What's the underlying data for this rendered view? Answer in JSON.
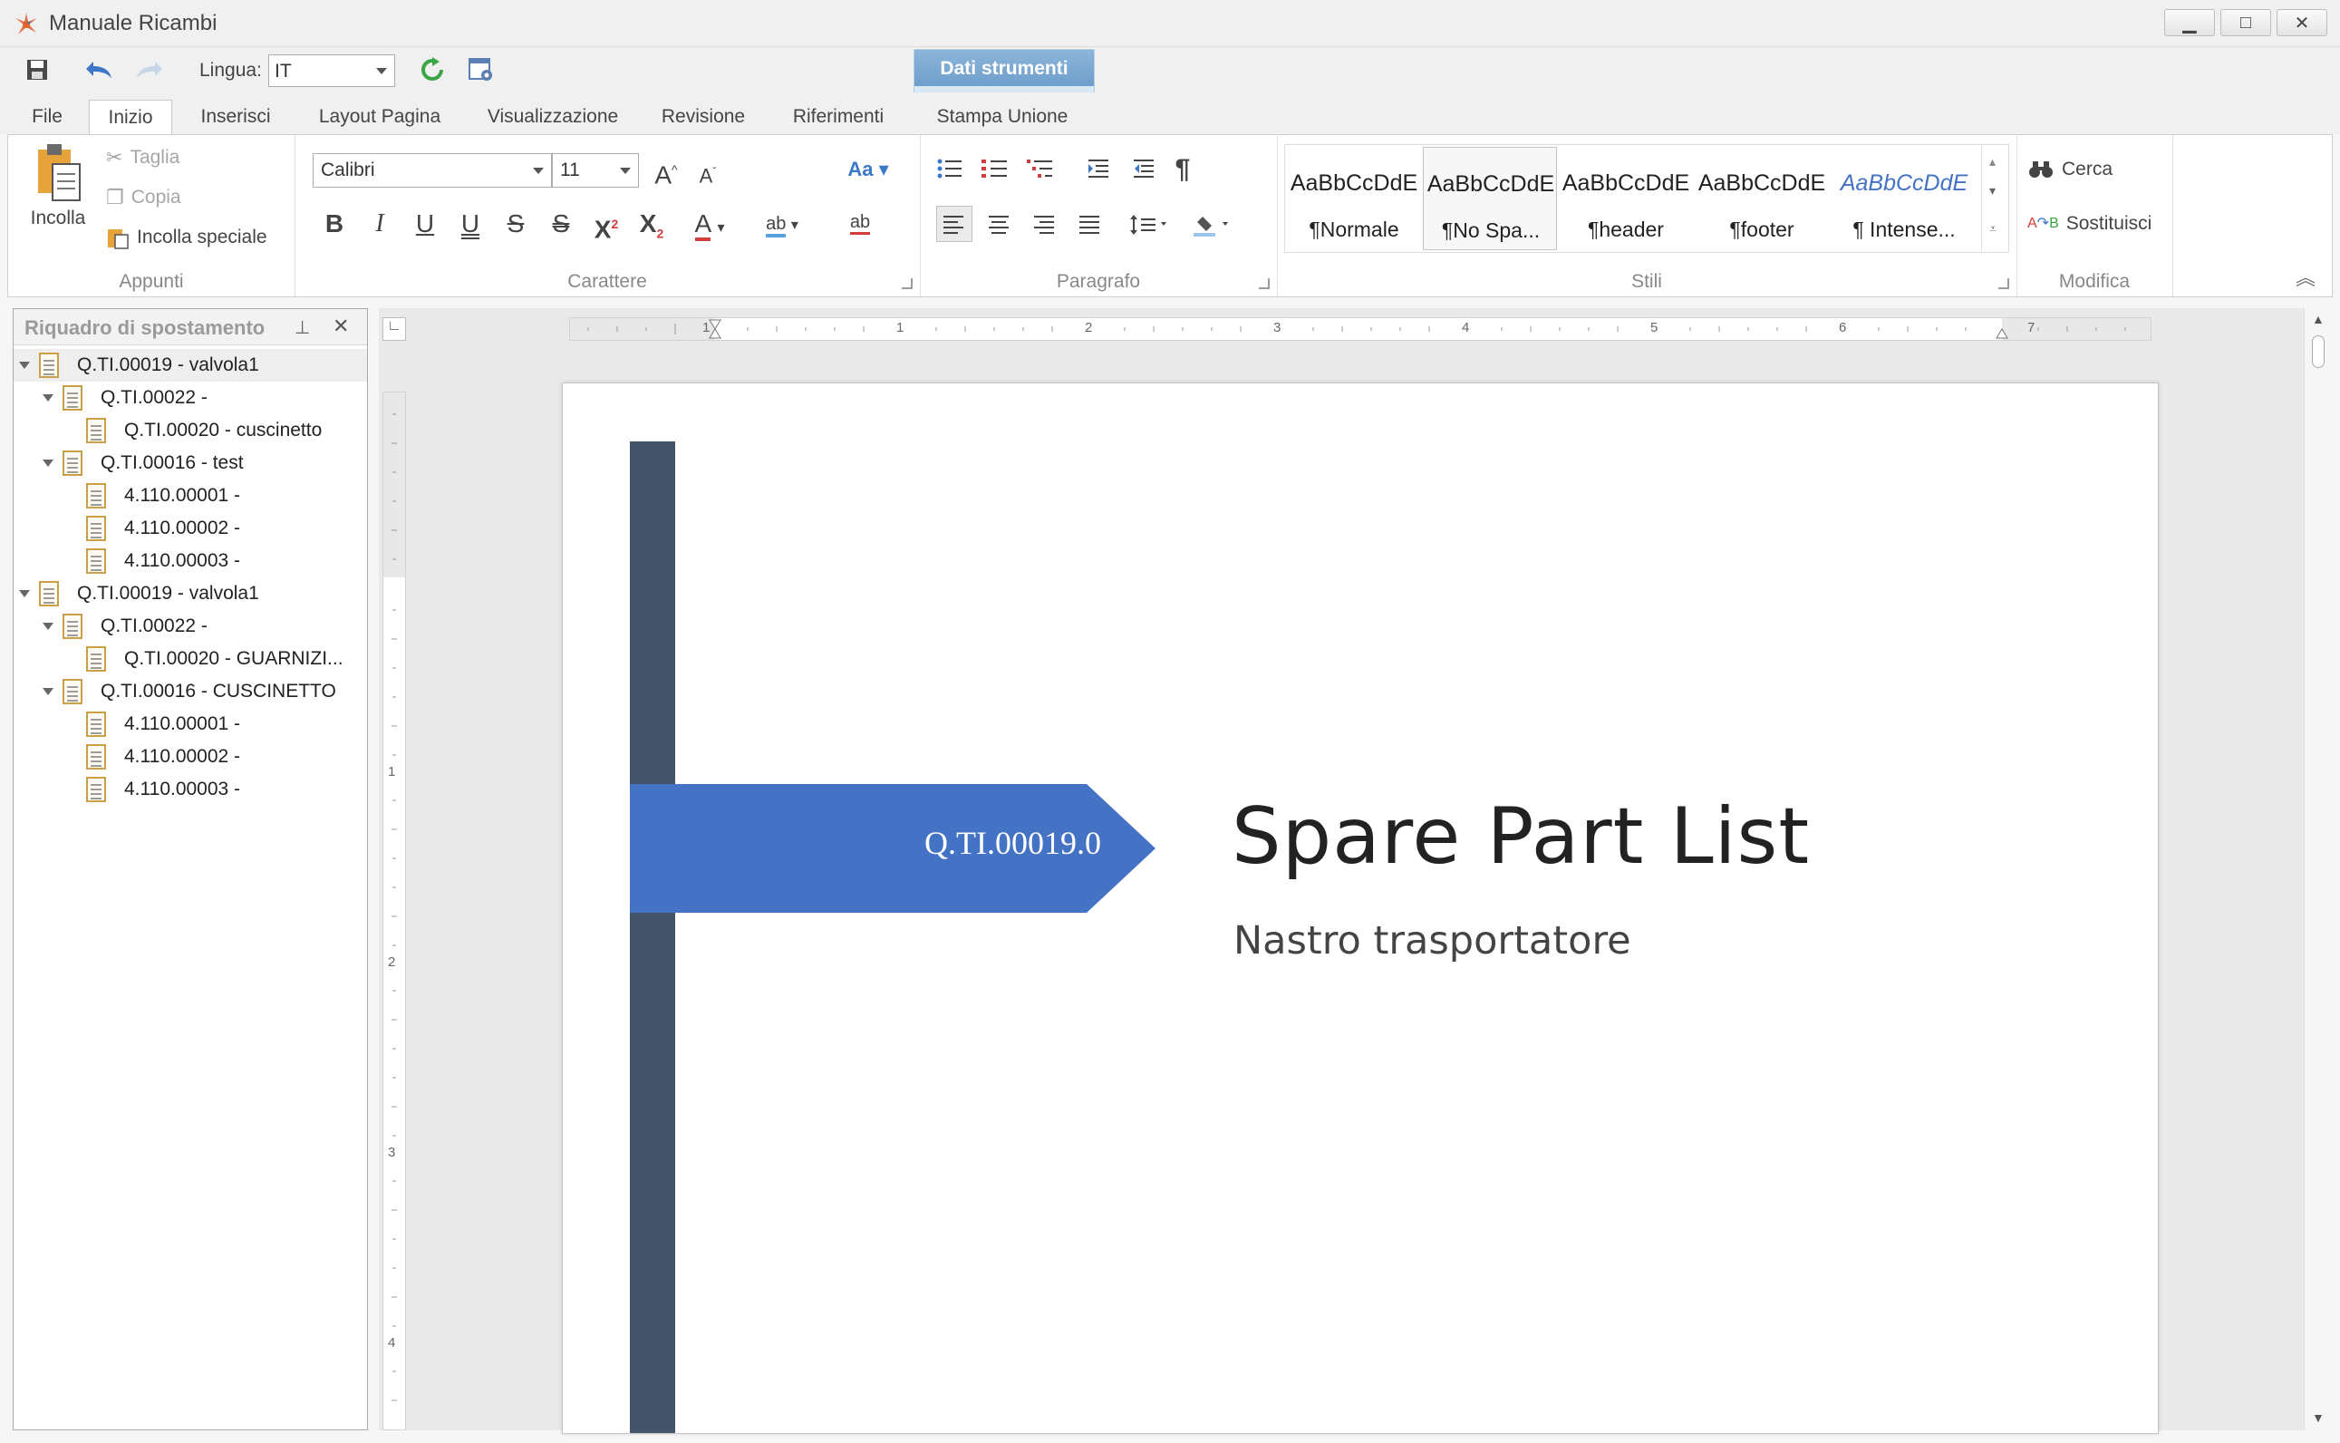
{
  "window": {
    "title": "Manuale Ricambi",
    "buttons": {
      "minimize": "▁",
      "maximize": "□",
      "close": "✕"
    }
  },
  "quick_access": {
    "language_label": "Lingua:",
    "language_value": "IT",
    "icons": [
      "save-icon",
      "undo-icon",
      "redo-icon",
      "refresh-icon",
      "settings-icon"
    ]
  },
  "tabs": [
    {
      "label": "File"
    },
    {
      "label": "Inizio"
    },
    {
      "label": "Inserisci"
    },
    {
      "label": "Layout Pagina"
    },
    {
      "label": "Visualizzazione"
    },
    {
      "label": "Revisione"
    },
    {
      "label": "Riferimenti"
    },
    {
      "label": "Stampa Unione"
    }
  ],
  "context_group_title": "Dati strumenti",
  "ribbon": {
    "clipboard": {
      "group_label": "Appunti",
      "paste": "Incolla",
      "cut": "Taglia",
      "copy": "Copia",
      "paste_special": "Incolla speciale"
    },
    "font": {
      "group_label": "Carattere",
      "family": "Calibri",
      "size": "11",
      "grow": "A",
      "shrink": "A",
      "change_case": "Aa",
      "bold": "B",
      "italic": "I",
      "underline": "U",
      "double_underline": "U",
      "strike": "S",
      "double_strike": "S",
      "superscript": "X",
      "subscript": "X",
      "font_color": "A",
      "highlight": "ab",
      "clear": "ab"
    },
    "paragraph": {
      "group_label": "Paragrafo",
      "pilcrow": "¶"
    },
    "styles": {
      "group_label": "Stili",
      "items": [
        {
          "sample": "AaBbCcDdE",
          "name": "¶Normale"
        },
        {
          "sample": "AaBbCcDdE",
          "name": "¶No Spa..."
        },
        {
          "sample": "AaBbCcDdE",
          "name": "¶header"
        },
        {
          "sample": "AaBbCcDdE",
          "name": "¶footer"
        },
        {
          "sample": "AaBbCcDdE",
          "name": "¶ Intense..."
        }
      ],
      "accent_color": "#4472c4"
    },
    "editing": {
      "group_label": "Modifica",
      "find": "Cerca",
      "replace": "Sostituisci"
    }
  },
  "navigation_pane": {
    "title": "Riquadro di spostamento",
    "items": [
      {
        "label": "Q.TI.00019 - valvola1",
        "level": 0,
        "expandable": true
      },
      {
        "label": "Q.TI.00022 -",
        "level": 1,
        "expandable": true
      },
      {
        "label": "Q.TI.00020 - cuscinetto",
        "level": 2,
        "expandable": false
      },
      {
        "label": "Q.TI.00016 - test",
        "level": 1,
        "expandable": true
      },
      {
        "label": "4.110.00001 -",
        "level": 2,
        "expandable": false
      },
      {
        "label": "4.110.00002 -",
        "level": 2,
        "expandable": false
      },
      {
        "label": "4.110.00003 -",
        "level": 2,
        "expandable": false
      },
      {
        "label": "Q.TI.00019 - valvola1",
        "level": 0,
        "expandable": true
      },
      {
        "label": "Q.TI.00022 -",
        "level": 1,
        "expandable": true
      },
      {
        "label": "Q.TI.00020 - GUARNIZI...",
        "level": 2,
        "expandable": false
      },
      {
        "label": "Q.TI.00016 - CUSCINETTO",
        "level": 1,
        "expandable": true
      },
      {
        "label": "4.110.00001 -",
        "level": 2,
        "expandable": false
      },
      {
        "label": "4.110.00002 -",
        "level": 2,
        "expandable": false
      },
      {
        "label": "4.110.00003 -",
        "level": 2,
        "expandable": false
      }
    ]
  },
  "rulers": {
    "horizontal_labels": [
      "1",
      "1",
      "2",
      "3",
      "4",
      "5",
      "6",
      "7"
    ],
    "vertical_labels": [
      "1",
      "2",
      "3",
      "4"
    ]
  },
  "document": {
    "banner_code": "Q.TI.00019.0",
    "title": "Spare Part List",
    "subtitle": "Nastro trasportatore",
    "colors": {
      "sidebar": "#44546a",
      "banner": "#4472c4"
    }
  }
}
